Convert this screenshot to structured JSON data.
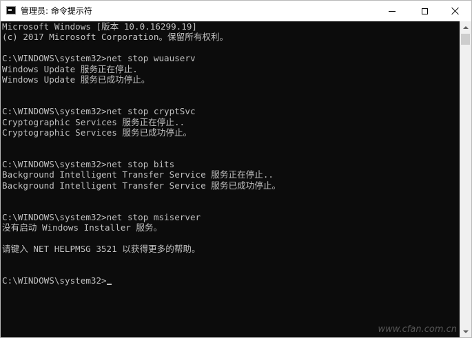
{
  "window": {
    "title": "管理员: 命令提示符",
    "colors": {
      "console_bg": "#0c0c0c",
      "console_fg": "#c0c0c0",
      "titlebar_bg": "#ffffff"
    }
  },
  "titlebar": {
    "icons": {
      "app": "cmd-icon",
      "minimize": "minimize-icon",
      "maximize": "maximize-icon",
      "close": "close-icon"
    }
  },
  "console": {
    "lines": [
      "Microsoft Windows [版本 10.0.16299.19]",
      "(c) 2017 Microsoft Corporation。保留所有权利。",
      "",
      "C:\\WINDOWS\\system32>net stop wuauserv",
      "Windows Update 服务正在停止.",
      "Windows Update 服务已成功停止。",
      "",
      "",
      "C:\\WINDOWS\\system32>net stop cryptSvc",
      "Cryptographic Services 服务正在停止..",
      "Cryptographic Services 服务已成功停止。",
      "",
      "",
      "C:\\WINDOWS\\system32>net stop bits",
      "Background Intelligent Transfer Service 服务正在停止..",
      "Background Intelligent Transfer Service 服务已成功停止。",
      "",
      "",
      "C:\\WINDOWS\\system32>net stop msiserver",
      "没有启动 Windows Installer 服务。",
      "",
      "请键入 NET HELPMSG 3521 以获得更多的帮助。",
      "",
      "",
      "C:\\WINDOWS\\system32>"
    ]
  },
  "watermark": "www.cfan.com.cn"
}
